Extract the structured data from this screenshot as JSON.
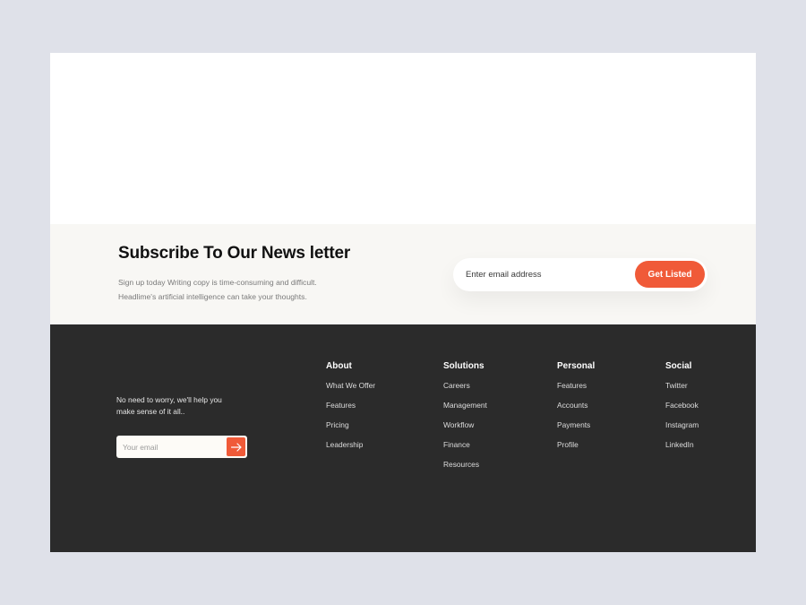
{
  "newsletter": {
    "title": "Subscribe To Our News letter",
    "description_line1": "Sign up today Writing copy is time-consuming and difficult.",
    "description_line2": "Headlime's artificial intelligence can take your thoughts.",
    "email_placeholder": "Enter email address",
    "button_label": "Get Listed"
  },
  "footer": {
    "tagline_line1": "No need to worry, we'll help you",
    "tagline_line2": "make sense of it all..",
    "email_placeholder": "Your email",
    "submit_icon": "arrow-right-icon",
    "columns": [
      {
        "title": "About",
        "links": [
          "What We Offer",
          "Features",
          "Pricing",
          "Leadership"
        ]
      },
      {
        "title": "Solutions",
        "links": [
          "Careers",
          "Management",
          "Workflow",
          "Finance",
          "Resources"
        ]
      },
      {
        "title": "Personal",
        "links": [
          "Features",
          "Accounts",
          "Payments",
          "Profile"
        ]
      },
      {
        "title": "Social",
        "links": [
          "Twitter",
          "Facebook",
          "Instagram",
          "LinkedIn"
        ]
      }
    ]
  },
  "colors": {
    "accent": "#f05a38",
    "footer_bg": "#2b2b2b",
    "newsletter_bg": "#f8f7f4",
    "page_bg": "#dfe1e9"
  }
}
